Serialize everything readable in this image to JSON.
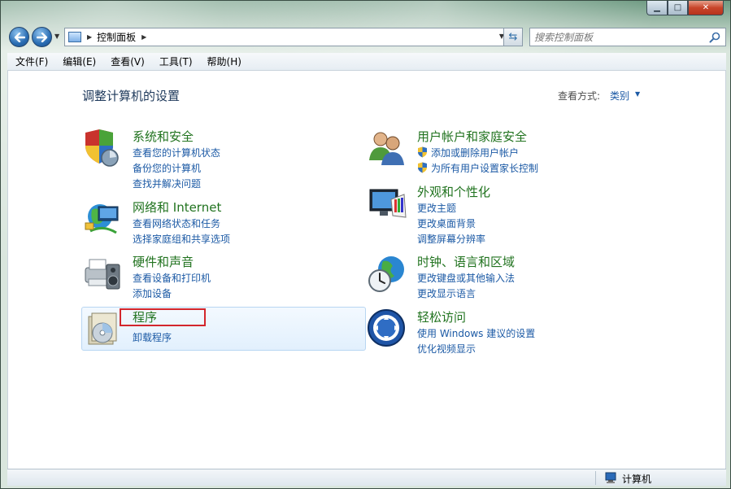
{
  "window": {
    "controls": {
      "minimize": "▁",
      "maximize": "□",
      "close": "✕"
    }
  },
  "address_bar": {
    "breadcrumb": "控制面板",
    "back_icon": "back-arrow-icon",
    "forward_icon": "forward-arrow-icon"
  },
  "search": {
    "placeholder": "搜索控制面板"
  },
  "menu": [
    "文件(F)",
    "编辑(E)",
    "查看(V)",
    "工具(T)",
    "帮助(H)"
  ],
  "main": {
    "title": "调整计算机的设置",
    "view_by_label": "查看方式:",
    "view_by_value": "类别",
    "categories": [
      {
        "title": "系统和安全",
        "icon": "shield-security-icon",
        "links": [
          "查看您的计算机状态",
          "备份您的计算机",
          "查找并解决问题"
        ]
      },
      {
        "title": "网络和 Internet",
        "icon": "network-globe-icon",
        "links": [
          "查看网络状态和任务",
          "选择家庭组和共享选项"
        ]
      },
      {
        "title": "硬件和声音",
        "icon": "printer-speaker-icon",
        "links": [
          "查看设备和打印机",
          "添加设备"
        ]
      },
      {
        "title": "程序",
        "icon": "programs-disc-icon",
        "links": [
          "卸载程序"
        ]
      },
      {
        "title": "用户帐户和家庭安全",
        "icon": "users-icon",
        "links": [
          "添加或删除用户帐户",
          "为所有用户设置家长控制"
        ]
      },
      {
        "title": "外观和个性化",
        "icon": "monitor-palette-icon",
        "links": [
          "更改主题",
          "更改桌面背景",
          "调整屏幕分辨率"
        ]
      },
      {
        "title": "时钟、语言和区域",
        "icon": "clock-globe-icon",
        "links": [
          "更改键盘或其他输入法",
          "更改显示语言"
        ]
      },
      {
        "title": "轻松访问",
        "icon": "ease-of-access-icon",
        "links": [
          "使用 Windows 建议的设置",
          "优化视频显示"
        ]
      }
    ]
  },
  "status_bar": {
    "text": "计算机",
    "icon": "computer-icon"
  },
  "colors": {
    "category_title": "#21731f",
    "link": "#1c5aa5",
    "page_title": "#1e395b",
    "highlight_box": "#d3262c"
  }
}
